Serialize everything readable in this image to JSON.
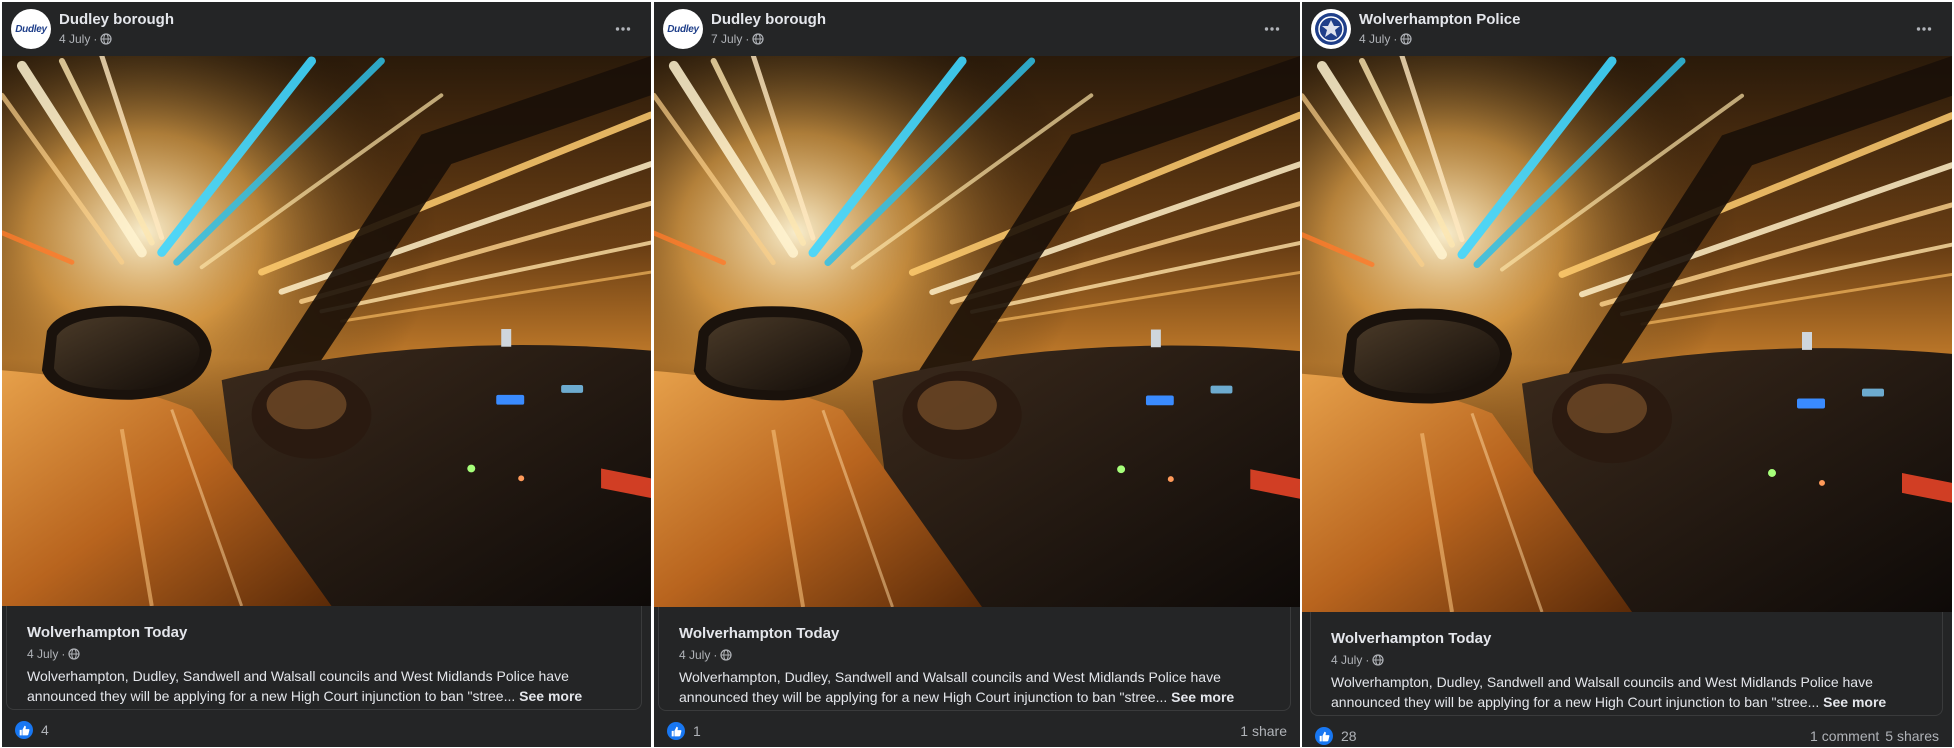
{
  "posts": [
    {
      "page_name": "Dudley borough",
      "avatar_text": "Dudley",
      "date": "4 July",
      "link_card": {
        "source": "Wolverhampton Today",
        "date": "4 July",
        "text": "Wolverhampton, Dudley, Sandwell and Walsall councils and West Midlands Police have announced they will be applying for a new High Court injunction to ban \"stree...",
        "see_more": "See more"
      },
      "reactions": "4",
      "comments": "",
      "shares": ""
    },
    {
      "page_name": "Dudley borough",
      "avatar_text": "Dudley",
      "date": "7 July",
      "link_card": {
        "source": "Wolverhampton Today",
        "date": "4 July",
        "text": "Wolverhampton, Dudley, Sandwell and Walsall councils and West Midlands Police have announced they will be applying for a new High Court injunction to ban \"stree...",
        "see_more": "See more"
      },
      "reactions": "1",
      "comments": "",
      "shares": "1 share"
    },
    {
      "page_name": "Wolverhampton Police",
      "avatar_text": "",
      "date": "4 July",
      "link_card": {
        "source": "Wolverhampton Today",
        "date": "4 July",
        "text": "Wolverhampton, Dudley, Sandwell and Walsall councils and West Midlands Police have announced they will be applying for a new High Court injunction to ban \"stree...",
        "see_more": "See more"
      },
      "reactions": "28",
      "comments": "1 comment",
      "shares": "5 shares"
    }
  ],
  "icons": {
    "audience": "globe-icon",
    "more": "more-options-icon",
    "reaction": "like-icon",
    "police_avatar": "police-crest-icon"
  },
  "colors": {
    "card_background": "#242526",
    "primary_text": "#e4e6eb",
    "secondary_text": "#b0b3b8",
    "like_blue": "#1877f2"
  }
}
